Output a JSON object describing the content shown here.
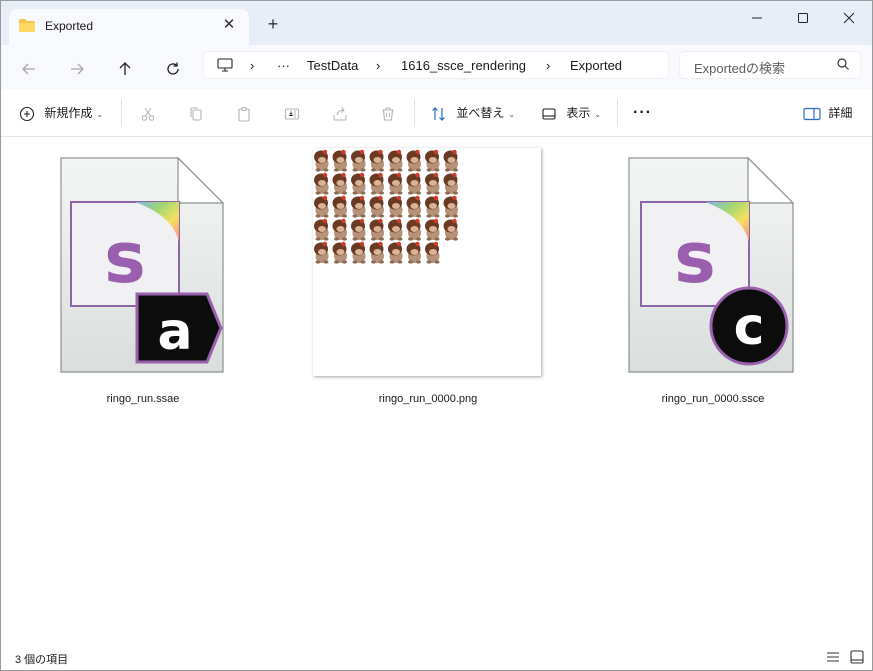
{
  "window": {
    "tab_title": "Exported",
    "close_tab": "✕",
    "new_tab": "+",
    "minimize": "—",
    "maximize": "☐",
    "close": "✕"
  },
  "nav": {
    "breadcrumb": [
      "TestData",
      "1616_ssce_rendering",
      "Exported"
    ],
    "ellipsis": "···",
    "search_placeholder": "Exportedの検索"
  },
  "toolbar": {
    "new_label": "新規作成",
    "sort_label": "並べ替え",
    "view_label": "表示",
    "more_label": "···",
    "details_label": "詳細"
  },
  "files": [
    {
      "name": "ringo_run.ssae",
      "icon": "sprite-studio-animation-icon",
      "badge": "a"
    },
    {
      "name": "ringo_run_0000.png",
      "icon": "png-thumbnail",
      "badge": ""
    },
    {
      "name": "ringo_run_0000.ssce",
      "icon": "sprite-studio-cell-icon",
      "badge": "c"
    }
  ],
  "status": {
    "item_count": "3 個の項目"
  },
  "colors": {
    "titlebar": "#e8eef7",
    "accent_purple": "#9b5fb0",
    "sprite_brown": "#8b5a3c"
  }
}
